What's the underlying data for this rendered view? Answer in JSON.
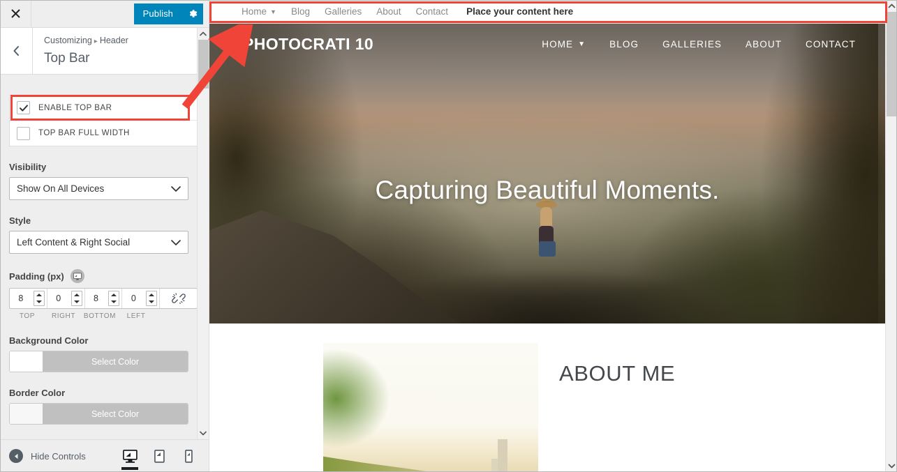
{
  "customizer": {
    "close_label": "×",
    "publish_label": "Publish",
    "gear_icon": "gear-icon",
    "breadcrumb_root": "Customizing",
    "breadcrumb_sep": "▸",
    "breadcrumb_parent": "Header",
    "panel_title": "Top Bar",
    "back_icon": "chevron-left-icon",
    "checkboxes": [
      {
        "label": "ENABLE TOP BAR",
        "checked": true
      },
      {
        "label": "TOP BAR FULL WIDTH",
        "checked": false
      }
    ],
    "visibility": {
      "label": "Visibility",
      "value": "Show On All Devices"
    },
    "style": {
      "label": "Style",
      "value": "Left Content & Right Social"
    },
    "padding": {
      "label": "Padding (px)",
      "device_icon": "desktop-icon",
      "values": [
        "8",
        "0",
        "8",
        "0"
      ],
      "legend": [
        "TOP",
        "RIGHT",
        "BOTTOM",
        "LEFT"
      ],
      "link_icon": "broken-link-icon"
    },
    "background_color": {
      "label": "Background Color",
      "button_label": "Select Color",
      "swatch": "#ffffff"
    },
    "border_color": {
      "label": "Border Color",
      "button_label": "Select Color",
      "swatch": "#f7f7f7"
    },
    "footer": {
      "hide_controls_label": "Hide Controls",
      "devices": [
        {
          "name": "desktop",
          "icon": "desktop-icon",
          "active": true
        },
        {
          "name": "tablet",
          "icon": "tablet-icon",
          "active": false
        },
        {
          "name": "mobile",
          "icon": "mobile-icon",
          "active": false
        }
      ]
    },
    "accent_color": "#0085ba"
  },
  "preview": {
    "top_bar": {
      "menu": [
        {
          "label": "Home",
          "has_caret": true
        },
        {
          "label": "Blog",
          "has_caret": false
        },
        {
          "label": "Galleries",
          "has_caret": false
        },
        {
          "label": "About",
          "has_caret": false
        },
        {
          "label": "Contact",
          "has_caret": false
        }
      ],
      "content_text": "Place your content here"
    },
    "site_header": {
      "logo": "PHOTOCRATI 10",
      "nav": [
        {
          "label": "HOME",
          "has_caret": true
        },
        {
          "label": "BLOG",
          "has_caret": false
        },
        {
          "label": "GALLERIES",
          "has_caret": false
        },
        {
          "label": "ABOUT",
          "has_caret": false
        },
        {
          "label": "CONTACT",
          "has_caret": false
        }
      ]
    },
    "hero": {
      "title": "Capturing Beautiful Moments."
    },
    "about": {
      "title": "ABOUT ME"
    }
  },
  "annotations": {
    "highlight_color": "#f04438",
    "boxes": [
      {
        "name": "top-bar-highlight"
      },
      {
        "name": "enable-top-bar-highlight"
      }
    ],
    "arrow": {
      "name": "callout-arrow"
    }
  }
}
